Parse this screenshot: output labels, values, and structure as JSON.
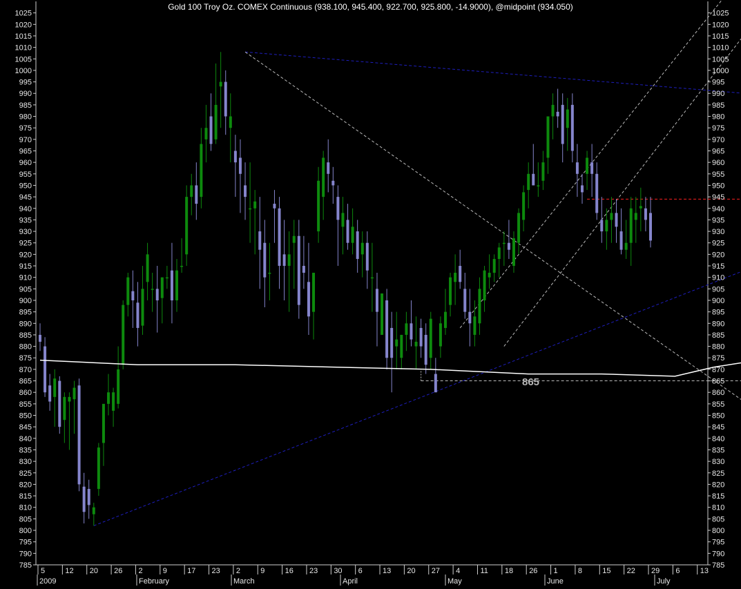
{
  "chart_data": {
    "type": "candlestick",
    "title": "Gold 100 Troy Oz. COMEX Continuous (938.100, 945.400, 922.700, 925.800, -14.9000), @midpoint (934.050)",
    "ylim": [
      785,
      1030
    ],
    "y_ticks": [
      785,
      790,
      795,
      800,
      805,
      810,
      815,
      820,
      825,
      830,
      835,
      840,
      845,
      850,
      855,
      860,
      865,
      870,
      875,
      880,
      885,
      890,
      895,
      900,
      905,
      910,
      915,
      920,
      925,
      930,
      935,
      940,
      945,
      950,
      955,
      960,
      965,
      970,
      975,
      980,
      985,
      990,
      995,
      1000,
      1005,
      1010,
      1015,
      1020,
      1025
    ],
    "x_day_labels": [
      "5",
      "12",
      "20",
      "26",
      "2",
      "9",
      "17",
      "23",
      "2",
      "9",
      "16",
      "23",
      "30",
      "6",
      "13",
      "20",
      "27",
      "4",
      "11",
      "18",
      "26",
      "1",
      "8",
      "15",
      "22",
      "29",
      "6",
      "13"
    ],
    "x_month_labels": [
      "2009",
      "February",
      "March",
      "April",
      "May",
      "June",
      "July"
    ],
    "grid": false,
    "candles": [
      [
        885,
        890,
        878,
        882
      ],
      [
        880,
        884,
        858,
        860
      ],
      [
        863,
        868,
        852,
        856
      ],
      [
        858,
        870,
        845,
        866
      ],
      [
        865,
        867,
        842,
        845
      ],
      [
        848,
        860,
        838,
        858
      ],
      [
        856,
        860,
        835,
        858
      ],
      [
        857,
        865,
        842,
        862
      ],
      [
        863,
        866,
        817,
        820
      ],
      [
        819,
        825,
        803,
        808
      ],
      [
        818,
        822,
        805,
        811
      ],
      [
        807,
        812,
        802,
        810
      ],
      [
        818,
        838,
        815,
        836
      ],
      [
        838,
        845,
        828,
        855
      ],
      [
        855,
        868,
        850,
        860
      ],
      [
        852,
        862,
        845,
        860
      ],
      [
        855,
        880,
        853,
        870
      ],
      [
        872,
        900,
        870,
        898
      ],
      [
        898,
        912,
        893,
        910
      ],
      [
        904,
        913,
        888,
        900
      ],
      [
        899,
        908,
        880,
        888
      ],
      [
        889,
        915,
        885,
        905
      ],
      [
        908,
        925,
        900,
        920
      ],
      [
        905,
        912,
        895,
        905
      ],
      [
        905,
        915,
        886,
        900
      ],
      [
        901,
        910,
        890,
        910
      ],
      [
        910,
        915,
        905,
        910
      ],
      [
        913,
        925,
        890,
        900
      ],
      [
        900,
        918,
        895,
        913
      ],
      [
        915,
        927,
        912,
        915
      ],
      [
        920,
        950,
        915,
        945
      ],
      [
        945,
        955,
        937,
        950
      ],
      [
        950,
        960,
        935,
        942
      ],
      [
        945,
        975,
        940,
        968
      ],
      [
        970,
        985,
        960,
        975
      ],
      [
        980,
        990,
        965,
        968
      ],
      [
        970,
        1003,
        968,
        985
      ],
      [
        993,
        1008,
        975,
        995
      ],
      [
        995,
        1000,
        972,
        980
      ],
      [
        975,
        990,
        960,
        980
      ],
      [
        965,
        972,
        945,
        960
      ],
      [
        962,
        970,
        938,
        955
      ],
      [
        950,
        960,
        935,
        945
      ],
      [
        940,
        960,
        925,
        940
      ],
      [
        940,
        948,
        920,
        943
      ],
      [
        930,
        945,
        905,
        922
      ],
      [
        925,
        935,
        897,
        910
      ],
      [
        912,
        925,
        900,
        912
      ],
      [
        942,
        948,
        925,
        940
      ],
      [
        940,
        945,
        905,
        915
      ],
      [
        920,
        935,
        900,
        915
      ],
      [
        915,
        930,
        895,
        920
      ],
      [
        925,
        935,
        905,
        928
      ],
      [
        928,
        935,
        892,
        898
      ],
      [
        915,
        928,
        905,
        912
      ],
      [
        908,
        925,
        885,
        893
      ],
      [
        895,
        912,
        883,
        912
      ],
      [
        930,
        958,
        925,
        952
      ],
      [
        945,
        965,
        935,
        962
      ],
      [
        960,
        970,
        947,
        955
      ],
      [
        952,
        958,
        942,
        950
      ],
      [
        945,
        950,
        915,
        935
      ],
      [
        932,
        945,
        920,
        938
      ],
      [
        935,
        942,
        922,
        925
      ],
      [
        925,
        940,
        920,
        932
      ],
      [
        930,
        935,
        912,
        918
      ],
      [
        920,
        930,
        910,
        925
      ],
      [
        925,
        930,
        905,
        913
      ],
      [
        910,
        925,
        895,
        910
      ],
      [
        905,
        912,
        880,
        895
      ],
      [
        885,
        903,
        885,
        903
      ],
      [
        900,
        905,
        870,
        875
      ],
      [
        888,
        895,
        860,
        875
      ],
      [
        880,
        895,
        870,
        883
      ],
      [
        875,
        885,
        870,
        885
      ],
      [
        885,
        895,
        878,
        890
      ],
      [
        890,
        900,
        880,
        883
      ],
      [
        880,
        893,
        870,
        882
      ],
      [
        888,
        892,
        875,
        880
      ],
      [
        885,
        890,
        868,
        872
      ],
      [
        875,
        895,
        870,
        892
      ],
      [
        868,
        875,
        862,
        860
      ],
      [
        880,
        893,
        875,
        890
      ],
      [
        888,
        905,
        885,
        895
      ],
      [
        898,
        912,
        893,
        910
      ],
      [
        908,
        920,
        898,
        912
      ],
      [
        915,
        922,
        905,
        908
      ],
      [
        905,
        912,
        892,
        895
      ],
      [
        895,
        905,
        880,
        890
      ],
      [
        885,
        900,
        880,
        893
      ],
      [
        890,
        910,
        885,
        905
      ],
      [
        900,
        915,
        895,
        913
      ],
      [
        910,
        920,
        905,
        912
      ],
      [
        912,
        920,
        908,
        918
      ],
      [
        918,
        925,
        910,
        923
      ],
      [
        925,
        930,
        915,
        925
      ],
      [
        925,
        935,
        918,
        922
      ],
      [
        915,
        930,
        912,
        927
      ],
      [
        925,
        940,
        920,
        938
      ],
      [
        935,
        950,
        930,
        947
      ],
      [
        948,
        960,
        940,
        955
      ],
      [
        955,
        968,
        950,
        950
      ],
      [
        950,
        960,
        945,
        950
      ],
      [
        952,
        965,
        948,
        960
      ],
      [
        962,
        975,
        955,
        980
      ],
      [
        980,
        990,
        970,
        985
      ],
      [
        982,
        992,
        975,
        980
      ],
      [
        985,
        990,
        960,
        968
      ],
      [
        975,
        988,
        965,
        983
      ],
      [
        985,
        990,
        960,
        965
      ],
      [
        960,
        968,
        945,
        955
      ],
      [
        950,
        955,
        942,
        947
      ],
      [
        955,
        965,
        948,
        962
      ],
      [
        960,
        968,
        945,
        955
      ],
      [
        955,
        960,
        935,
        938
      ],
      [
        935,
        945,
        925,
        930
      ],
      [
        930,
        940,
        922,
        935
      ],
      [
        935,
        945,
        925,
        938
      ],
      [
        938,
        944,
        925,
        932
      ],
      [
        930,
        940,
        920,
        922
      ],
      [
        922,
        935,
        918,
        925
      ],
      [
        925,
        945,
        915,
        940
      ],
      [
        935,
        945,
        925,
        938
      ],
      [
        940,
        949,
        930,
        941
      ],
      [
        940,
        945,
        930,
        935
      ],
      [
        938,
        945,
        923,
        926
      ]
    ],
    "lines": {
      "moving_average": [
        [
          0,
          874
        ],
        [
          20,
          872
        ],
        [
          40,
          872
        ],
        [
          60,
          871
        ],
        [
          80,
          870
        ],
        [
          100,
          868
        ],
        [
          115,
          868
        ],
        [
          130,
          867
        ],
        [
          138,
          871
        ],
        [
          147,
          874
        ],
        [
          155,
          876
        ]
      ]
    },
    "annotations": [
      "865"
    ],
    "colors": {
      "up": "#0d8a0d",
      "down": "#8585cc",
      "moving_average": "#ffffff",
      "trend_blue": "#1e1ebe",
      "dotted": "#bcbcbc",
      "resistance": "#ff2020"
    }
  }
}
